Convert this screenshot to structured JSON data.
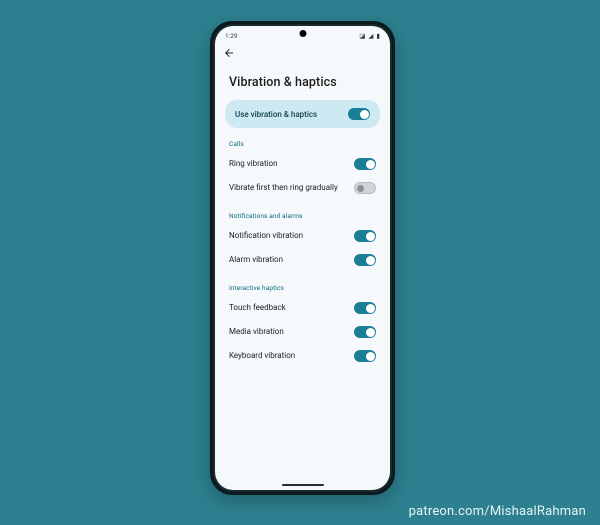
{
  "status": {
    "time": "1:29",
    "icons": [
      "clock-icon",
      "wifi-icon",
      "signal-icon",
      "battery-icon"
    ]
  },
  "header": {
    "title": "Vibration & haptics"
  },
  "master": {
    "label": "Use vibration & haptics",
    "on": true
  },
  "sections": [
    {
      "header": "Calls",
      "items": [
        {
          "label": "Ring vibration",
          "on": true
        },
        {
          "label": "Vibrate first then ring gradually",
          "on": false
        }
      ]
    },
    {
      "header": "Notifications and alarms",
      "items": [
        {
          "label": "Notification vibration",
          "on": true
        },
        {
          "label": "Alarm vibration",
          "on": true
        }
      ]
    },
    {
      "header": "Interactive haptics",
      "items": [
        {
          "label": "Touch feedback",
          "on": true
        },
        {
          "label": "Media vibration",
          "on": true
        },
        {
          "label": "Keyboard vibration",
          "on": true
        }
      ]
    }
  ],
  "attribution": "patreon.com/MishaalRahman",
  "colors": {
    "bg": "#2d808f",
    "accent": "#1a7f96",
    "master_bg": "#cde9f2",
    "section_hdr": "#0a6b7e"
  }
}
